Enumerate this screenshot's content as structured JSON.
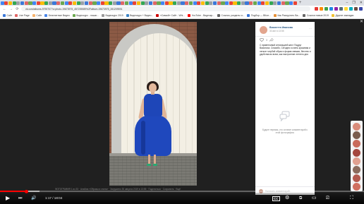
{
  "browser": {
    "tab_count": 74,
    "new_tab_label": "+",
    "window_controls": [
      "–",
      "❐",
      "✕"
    ],
    "nav": {
      "back": "←",
      "forward": "→",
      "reload": "⟳",
      "home": "⌂"
    },
    "url": "vk.com/albums-9790707?z=photo-19673975_457239089%2Falbum-19673975_281209591",
    "bookmarks": [
      {
        "label": "Сайт",
        "color": "#3c78d8"
      },
      {
        "label": "Live Page",
        "color": "#e06666"
      },
      {
        "label": "Сайт",
        "color": "#f6b26b"
      },
      {
        "label": "Бесплатные Видео",
        "color": "#4a86e8"
      },
      {
        "label": "Видеокурс - пошаг...",
        "color": "#6aa84f"
      },
      {
        "label": "Видеокурс 2019",
        "color": "#999999"
      },
      {
        "label": "Видеокурс + Видео...",
        "color": "#3d85c6"
      },
      {
        "label": "«Самый» Сайт - Whi...",
        "color": "#cc0000"
      },
      {
        "label": "YouTube - Видеокр...",
        "color": "#ff0000"
      },
      {
        "label": "Ссылки, разделы и...",
        "color": "#666666"
      },
      {
        "label": "Подбор — ВКон...",
        "color": "#3c78d8"
      },
      {
        "label": "Как Раскрутить Ва...",
        "color": "#e69138"
      },
      {
        "label": "Ссылки новые 2019",
        "color": "#666666"
      },
      {
        "label": "Другие закладки",
        "color": "#f1c232"
      }
    ]
  },
  "photo_viewer": {
    "close_label": "✕",
    "author": "Виолетта Иванова",
    "date": "30 авг в 13:55",
    "menu": "···",
    "like_count": "3",
    "description": "С приветливой интонацией жест Подруг Василиса. Спасибо, Сегодня я очень красивая и легкое голубой образ и форма свежая, бегство и удобства во всем, как настроение летнего дня",
    "no_comments_text": "Будьте первым, кто оставит комментарий к этой фотографии.",
    "comment_placeholder": "Написать комментарий...",
    "caption": "ФОТОГРАФИЯ 1 из 33  ·  Альбом «Образы и стиль»  ·  Загружено 30 августа 2019 в 13:55  ·  Поделиться  ·  Сохранить  ·  Ещё"
  },
  "chat_heads": [
    "#d98b7a",
    "#7a5c4e",
    "#c96b5b",
    "#a5473f",
    "#e0a090",
    "#8c6b5d",
    "#b35a4f",
    "#d07060"
  ],
  "player": {
    "played_fraction": 0.073,
    "buffered_fraction": 0.108,
    "time": "1:17 / 18:04",
    "play_icon": "▶",
    "next_icon": "⏭",
    "volume_icon": "🔊",
    "cc_icon": "CC",
    "settings_icon": "⚙",
    "miniplayer_icon": "⧉",
    "theater_icon": "▭",
    "cast_icon": "⎚",
    "fullscreen_icon": "⛶"
  }
}
